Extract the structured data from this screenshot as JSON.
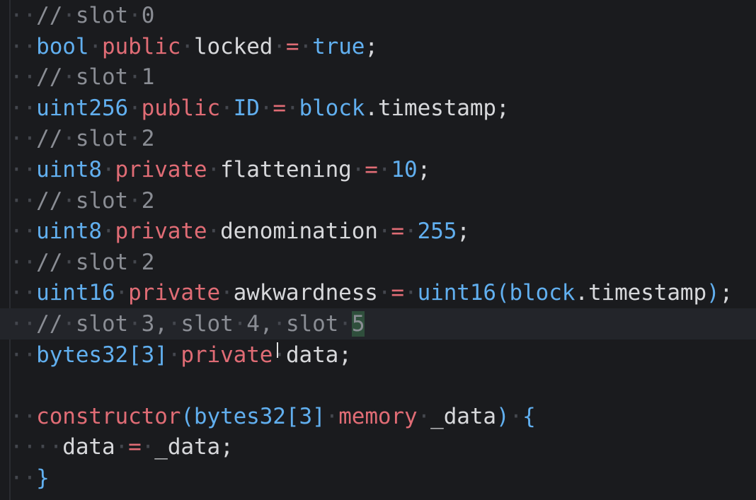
{
  "editor": {
    "lines": [
      {
        "tokens": [
          [
            "ws",
            "··"
          ],
          [
            "cm",
            "//"
          ],
          [
            "ws",
            "·"
          ],
          [
            "cm",
            "slot"
          ],
          [
            "ws",
            "·"
          ],
          [
            "cm",
            "0"
          ]
        ]
      },
      {
        "tokens": [
          [
            "ws",
            "··"
          ],
          [
            "ty",
            "bool"
          ],
          [
            "ws",
            "·"
          ],
          [
            "kw",
            "public"
          ],
          [
            "ws",
            "·"
          ],
          [
            "id",
            "locked"
          ],
          [
            "ws",
            "·"
          ],
          [
            "op",
            "="
          ],
          [
            "ws",
            "·"
          ],
          [
            "cn",
            "true"
          ],
          [
            "pn",
            ";"
          ]
        ]
      },
      {
        "tokens": [
          [
            "ws",
            "··"
          ],
          [
            "cm",
            "//"
          ],
          [
            "ws",
            "·"
          ],
          [
            "cm",
            "slot"
          ],
          [
            "ws",
            "·"
          ],
          [
            "cm",
            "1"
          ]
        ]
      },
      {
        "tokens": [
          [
            "ws",
            "··"
          ],
          [
            "ty",
            "uint256"
          ],
          [
            "ws",
            "·"
          ],
          [
            "kw",
            "public"
          ],
          [
            "ws",
            "·"
          ],
          [
            "ty",
            "ID"
          ],
          [
            "ws",
            "·"
          ],
          [
            "op",
            "="
          ],
          [
            "ws",
            "·"
          ],
          [
            "ty",
            "block"
          ],
          [
            "pn",
            ".timestamp;"
          ]
        ]
      },
      {
        "tokens": [
          [
            "ws",
            "··"
          ],
          [
            "cm",
            "//"
          ],
          [
            "ws",
            "·"
          ],
          [
            "cm",
            "slot"
          ],
          [
            "ws",
            "·"
          ],
          [
            "cm",
            "2"
          ]
        ]
      },
      {
        "tokens": [
          [
            "ws",
            "··"
          ],
          [
            "ty",
            "uint8"
          ],
          [
            "ws",
            "·"
          ],
          [
            "kw",
            "private"
          ],
          [
            "ws",
            "·"
          ],
          [
            "id",
            "flattening"
          ],
          [
            "ws",
            "·"
          ],
          [
            "op",
            "="
          ],
          [
            "ws",
            "·"
          ],
          [
            "nm",
            "10"
          ],
          [
            "pn",
            ";"
          ]
        ]
      },
      {
        "tokens": [
          [
            "ws",
            "··"
          ],
          [
            "cm",
            "//"
          ],
          [
            "ws",
            "·"
          ],
          [
            "cm",
            "slot"
          ],
          [
            "ws",
            "·"
          ],
          [
            "cm",
            "2"
          ]
        ]
      },
      {
        "tokens": [
          [
            "ws",
            "··"
          ],
          [
            "ty",
            "uint8"
          ],
          [
            "ws",
            "·"
          ],
          [
            "kw",
            "private"
          ],
          [
            "ws",
            "·"
          ],
          [
            "id",
            "denomination"
          ],
          [
            "ws",
            "·"
          ],
          [
            "op",
            "="
          ],
          [
            "ws",
            "·"
          ],
          [
            "nm",
            "255"
          ],
          [
            "pn",
            ";"
          ]
        ]
      },
      {
        "tokens": [
          [
            "ws",
            "··"
          ],
          [
            "cm",
            "//"
          ],
          [
            "ws",
            "·"
          ],
          [
            "cm",
            "slot"
          ],
          [
            "ws",
            "·"
          ],
          [
            "cm",
            "2"
          ]
        ]
      },
      {
        "tokens": [
          [
            "ws",
            "··"
          ],
          [
            "ty",
            "uint16"
          ],
          [
            "ws",
            "·"
          ],
          [
            "kw",
            "private"
          ],
          [
            "ws",
            "·"
          ],
          [
            "id",
            "awkwardness"
          ],
          [
            "ws",
            "·"
          ],
          [
            "op",
            "="
          ],
          [
            "ws",
            "·"
          ],
          [
            "ty",
            "uint16"
          ],
          [
            "br",
            "("
          ],
          [
            "ty",
            "block"
          ],
          [
            "pn",
            ".timestamp"
          ],
          [
            "br",
            ")"
          ],
          [
            "pn",
            ";"
          ]
        ]
      },
      {
        "active": true,
        "tokens": [
          [
            "ws",
            "··"
          ],
          [
            "cm",
            "//"
          ],
          [
            "ws",
            "·"
          ],
          [
            "cm",
            "slot"
          ],
          [
            "ws",
            "·"
          ],
          [
            "cm",
            "3,"
          ],
          [
            "ws",
            "·"
          ],
          [
            "cm",
            "slot"
          ],
          [
            "ws",
            "·"
          ],
          [
            "cm",
            "4,"
          ],
          [
            "ws",
            "·"
          ],
          [
            "cm",
            "slot"
          ],
          [
            "ws",
            "·"
          ],
          [
            "hl",
            "5"
          ]
        ]
      },
      {
        "tokens": [
          [
            "ws",
            "··"
          ],
          [
            "ty",
            "bytes32"
          ],
          [
            "br",
            "["
          ],
          [
            "nm",
            "3"
          ],
          [
            "br",
            "]"
          ],
          [
            "ws",
            "·"
          ],
          [
            "kw",
            "private"
          ],
          [
            "cursor",
            ""
          ],
          [
            "ws",
            "·"
          ],
          [
            "id",
            "data"
          ],
          [
            "pn",
            ";"
          ]
        ]
      },
      {
        "tokens": []
      },
      {
        "tokens": [
          [
            "ws",
            "··"
          ],
          [
            "kw",
            "constructor"
          ],
          [
            "br",
            "("
          ],
          [
            "ty",
            "bytes32"
          ],
          [
            "br",
            "["
          ],
          [
            "nm",
            "3"
          ],
          [
            "br",
            "]"
          ],
          [
            "ws",
            "·"
          ],
          [
            "kw",
            "memory"
          ],
          [
            "ws",
            "·"
          ],
          [
            "id",
            "_data"
          ],
          [
            "br",
            ")"
          ],
          [
            "ws",
            "·"
          ],
          [
            "br",
            "{"
          ]
        ]
      },
      {
        "tokens": [
          [
            "ws",
            "····"
          ],
          [
            "id",
            "data"
          ],
          [
            "ws",
            "·"
          ],
          [
            "op",
            "="
          ],
          [
            "ws",
            "·"
          ],
          [
            "id",
            "_data"
          ],
          [
            "pn",
            ";"
          ]
        ]
      },
      {
        "tokens": [
          [
            "ws",
            "··"
          ],
          [
            "br",
            "}"
          ]
        ]
      }
    ]
  },
  "colors": {
    "background": "#1a1b1e",
    "keyword": "#e06c75",
    "type": "#61afef",
    "comment": "#8a8d94",
    "text": "#d7d8db",
    "highlight": "#2f4f3c"
  }
}
